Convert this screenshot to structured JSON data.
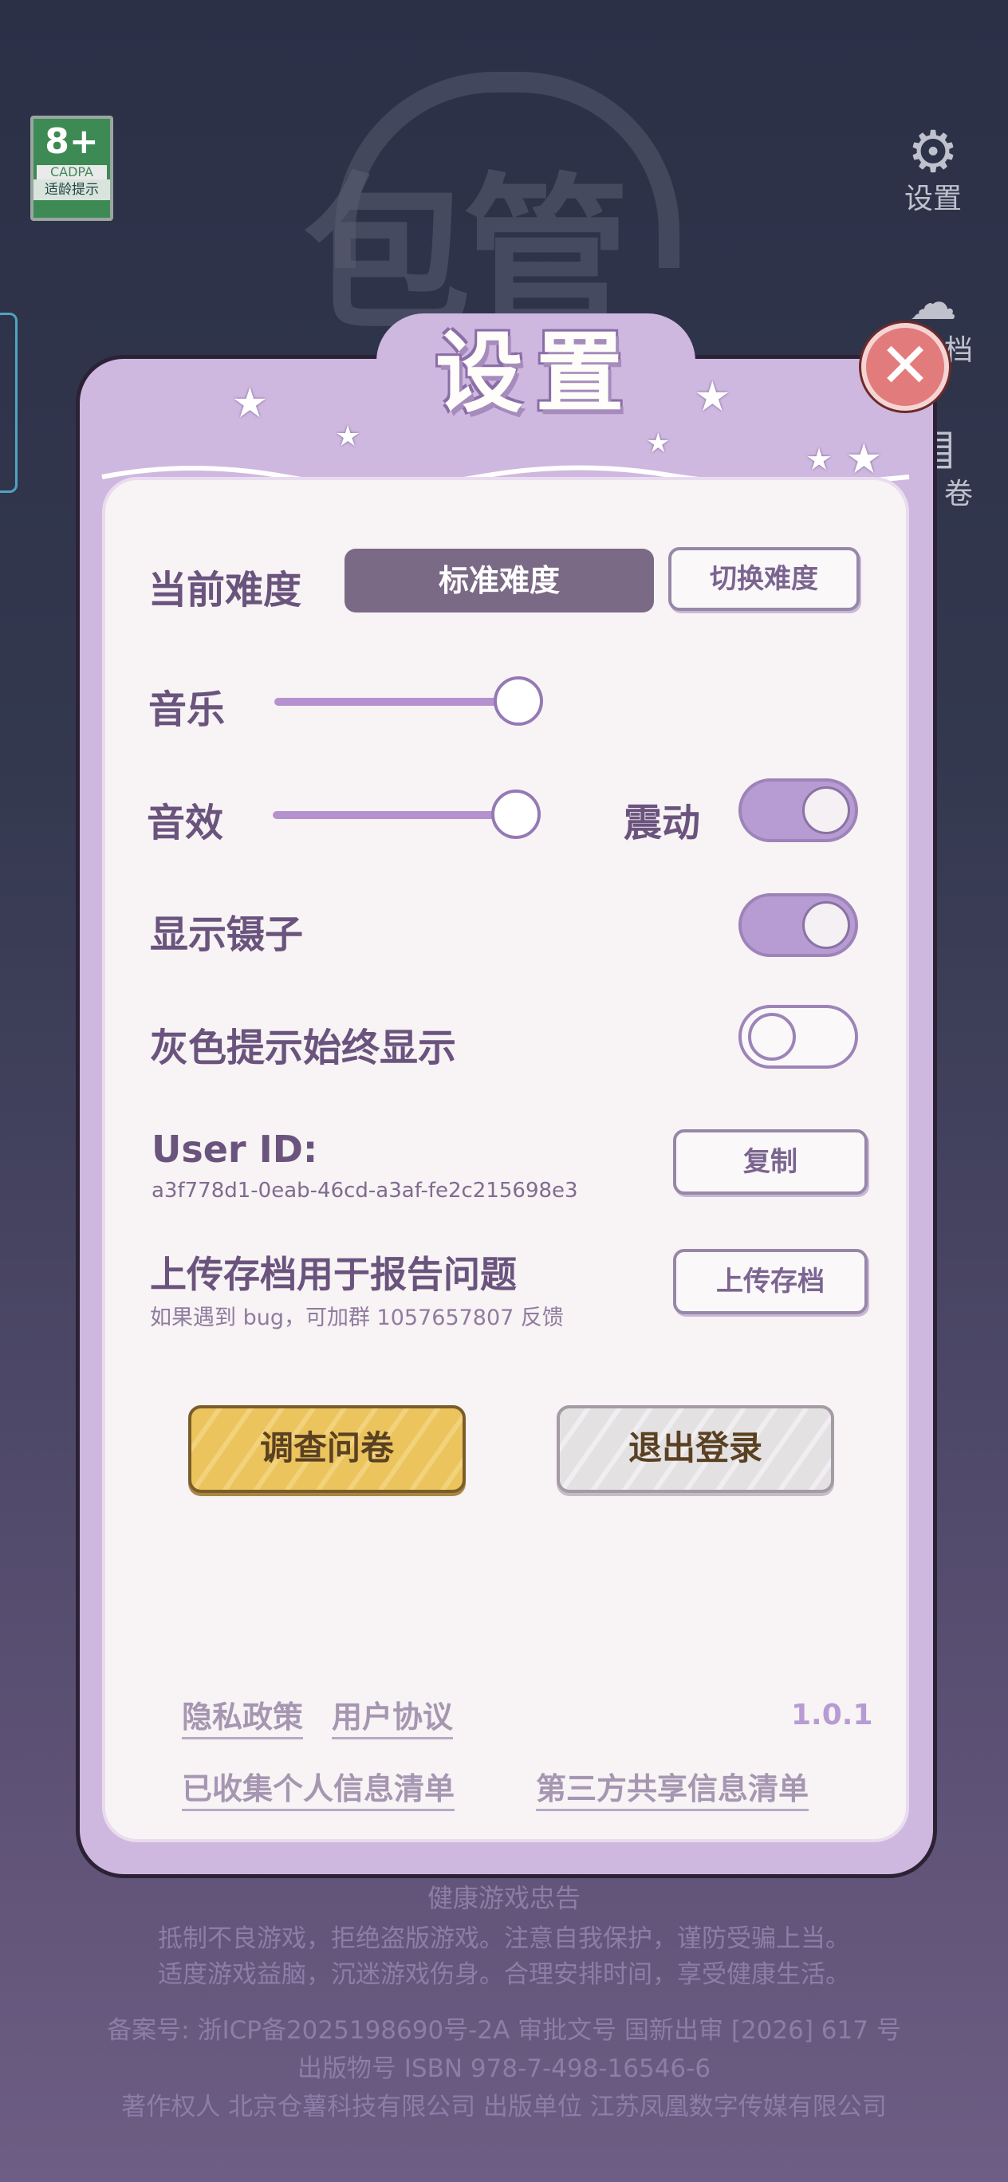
{
  "background": {
    "age_rating": {
      "number": "8+",
      "org": "CADPA",
      "tip": "适龄提示"
    },
    "side_buttons": [
      {
        "icon": "gear-icon",
        "label": "设置"
      },
      {
        "icon": "cloud-upload-icon",
        "label": "档"
      },
      {
        "icon": "questionnaire-icon",
        "label": "卷"
      }
    ],
    "health_notice": {
      "title": "健康游戏忠告",
      "line1": "抵制不良游戏，拒绝盗版游戏。注意自我保护，谨防受骗上当。",
      "line2": "适度游戏益脑，沉迷游戏伤身。合理安排时间，享受健康生活。",
      "line3": "备案号: 浙ICP备2025198690号-2A 审批文号 国新出审 [2026] 617 号",
      "line4": "出版物号 ISBN 978-7-498-16546-6",
      "line5": "著作权人 北京仓薯科技有限公司 出版单位 江苏凤凰数字传媒有限公司"
    }
  },
  "settings": {
    "title": "设置",
    "close_icon": "close-icon",
    "difficulty": {
      "label": "当前难度",
      "value": "标准难度",
      "switch_button": "切换难度"
    },
    "music": {
      "label": "音乐",
      "level": 0.92
    },
    "sfx": {
      "label": "音效",
      "level": 0.92
    },
    "vibration": {
      "label": "震动",
      "on": true
    },
    "show_tweezers": {
      "label": "显示镊子",
      "on": true
    },
    "gray_hint": {
      "label": "灰色提示始终显示",
      "on": false
    },
    "user_id": {
      "label": "User ID:",
      "value": "a3f778d1-0eab-46cd-a3af-fe2c215698e3",
      "copy_button": "复制"
    },
    "upload": {
      "label": "上传存档用于报告问题",
      "hint": "如果遇到 bug，可加群 1057657807 反馈",
      "button": "上传存档"
    },
    "survey_button": "调查问卷",
    "logout_button": "退出登录",
    "links": {
      "privacy": "隐私政策",
      "agreement": "用户协议",
      "collected_info": "已收集个人信息清单",
      "third_party": "第三方共享信息清单"
    },
    "version": "1.0.1"
  },
  "colors": {
    "panel": "#cfb8df",
    "accent": "#b79bd3",
    "survey": "#ecc45e",
    "close": "#e27c7c"
  }
}
